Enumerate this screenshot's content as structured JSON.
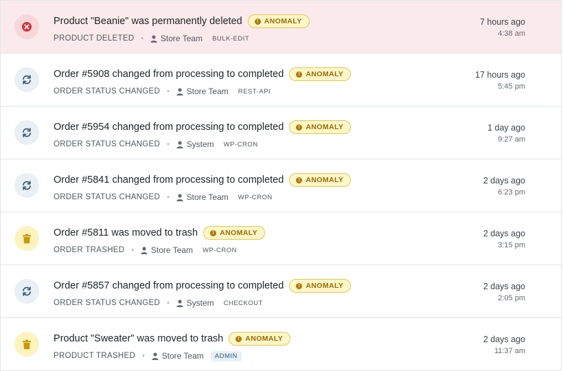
{
  "badge_label": "ANOMALY",
  "events": [
    {
      "title": "Product \"Beanie\" was permanently deleted",
      "type": "PRODUCT DELETED",
      "user": "Store Team",
      "source": "BULK-EDIT",
      "relative_time": "7 hours ago",
      "time": "4:38 am",
      "icon": "close-icon"
    },
    {
      "title": "Order #5908 changed from processing to completed",
      "type": "ORDER STATUS CHANGED",
      "user": "Store Team",
      "source": "REST-API",
      "relative_time": "17 hours ago",
      "time": "5:45 pm",
      "icon": "refresh-icon"
    },
    {
      "title": "Order #5954 changed from processing to completed",
      "type": "ORDER STATUS CHANGED",
      "user": "System",
      "source": "WP-CRON",
      "relative_time": "1 day ago",
      "time": "9:27 am",
      "icon": "refresh-icon"
    },
    {
      "title": "Order #5841 changed from processing to completed",
      "type": "ORDER STATUS CHANGED",
      "user": "Store Team",
      "source": "WP-CRON",
      "relative_time": "2 days ago",
      "time": "6:23 pm",
      "icon": "refresh-icon"
    },
    {
      "title": "Order #5811 was moved to trash",
      "type": "ORDER TRASHED",
      "user": "Store Team",
      "source": "WP-CRON",
      "relative_time": "2 days ago",
      "time": "3:15 pm",
      "icon": "trash-icon"
    },
    {
      "title": "Order #5857 changed from processing to completed",
      "type": "ORDER STATUS CHANGED",
      "user": "System",
      "source": "CHECKOUT",
      "relative_time": "2 days ago",
      "time": "2:05 pm",
      "icon": "refresh-icon"
    },
    {
      "title": "Product \"Sweater\" was moved to trash",
      "type": "PRODUCT TRASHED",
      "user": "Store Team",
      "source": "ADMIN",
      "relative_time": "2 days ago",
      "time": "11:37 am",
      "icon": "trash-icon"
    }
  ],
  "colors": {
    "deleted_row_bg": "#fbeaec",
    "anomaly_badge_bg": "#fdf6c8",
    "anomaly_badge_text": "#9a6b00",
    "delete_icon": "#d63638",
    "status_icon": "#3a5a78",
    "trash_icon": "#c99a00"
  }
}
